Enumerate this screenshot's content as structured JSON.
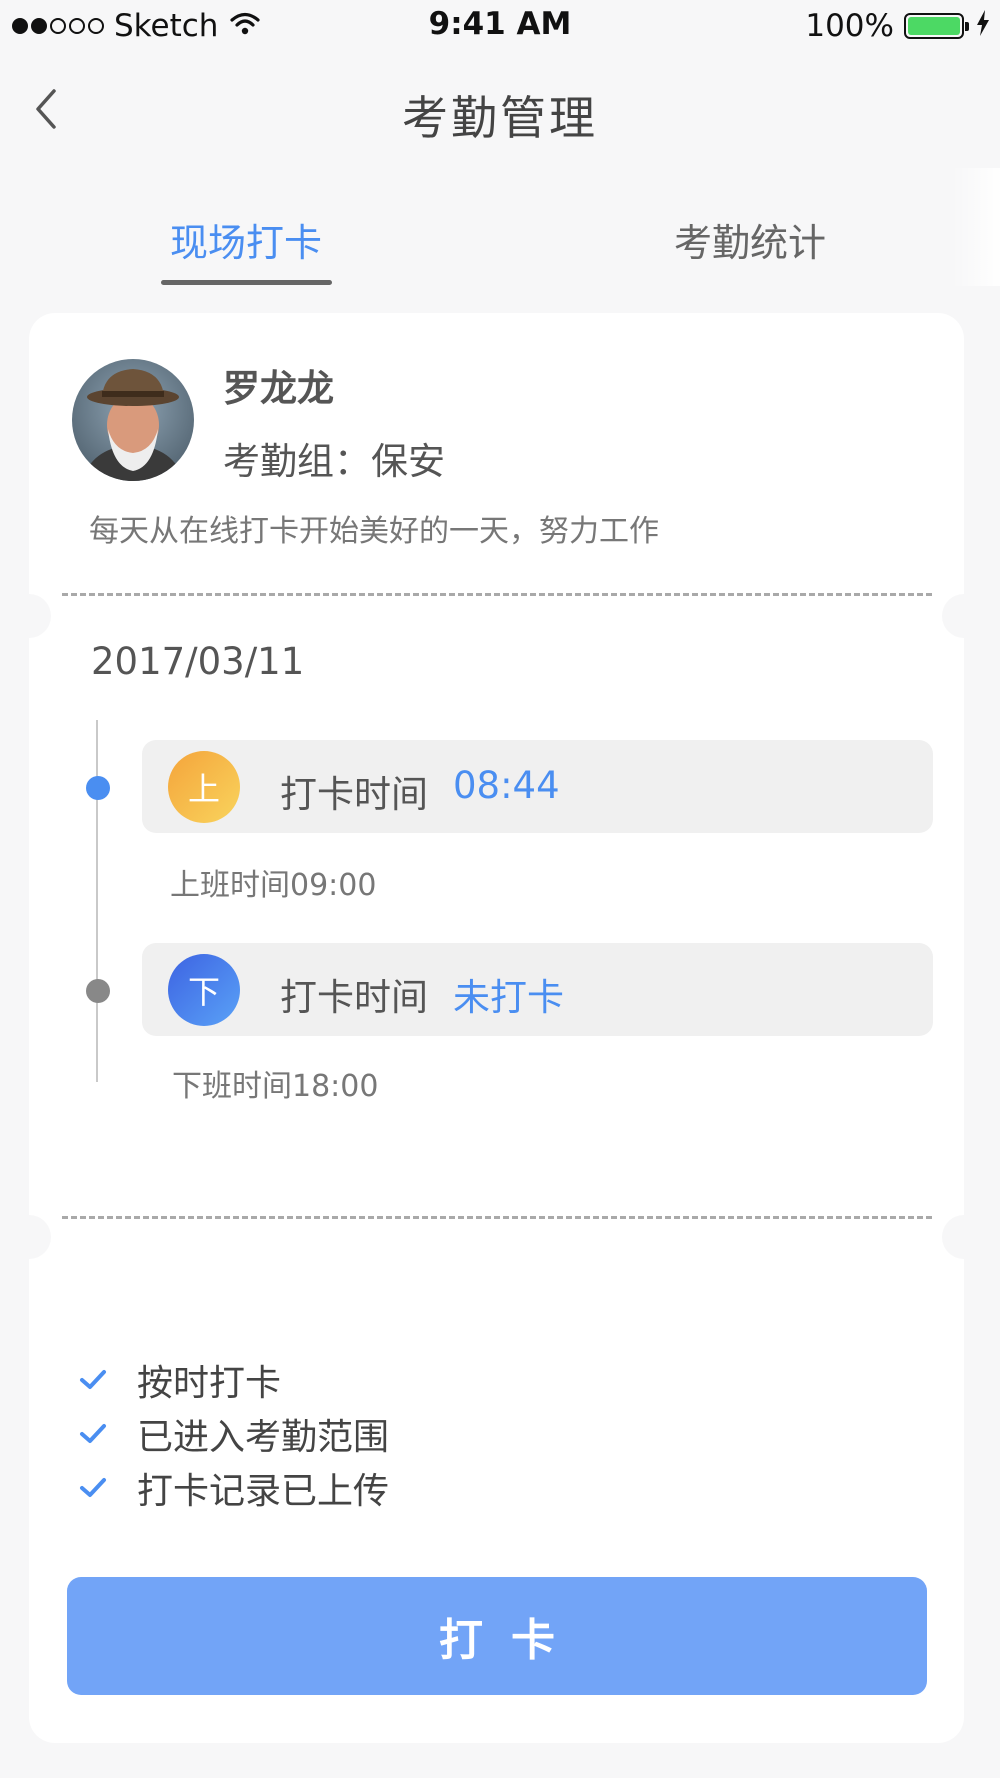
{
  "status_bar": {
    "carrier": "Sketch",
    "time": "9:41 AM",
    "battery": "100%",
    "signal_icon": "signal-dots-icon",
    "wifi_icon": "wifi-icon",
    "battery_icon": "battery-icon",
    "charging_icon": "lightning-icon"
  },
  "nav": {
    "title": "考勤管理",
    "back_icon": "chevron-left-icon"
  },
  "tabs": [
    {
      "label": "现场打卡",
      "active": true
    },
    {
      "label": "考勤统计",
      "active": false
    }
  ],
  "profile": {
    "name": "罗龙龙",
    "group": "考勤组：保安",
    "motto": "每天从在线打卡开始美好的一天，努力工作"
  },
  "date": "2017/03/11",
  "punches": [
    {
      "badge": "上",
      "label": "打卡时间",
      "value": "08:44",
      "schedule": "上班时间09:00"
    },
    {
      "badge": "下",
      "label": "打卡时间",
      "value": "未打卡",
      "schedule": "下班时间18:00"
    }
  ],
  "checks": [
    {
      "text": "按时打卡",
      "icon": "check-icon"
    },
    {
      "text": "已进入考勤范围",
      "icon": "check-icon"
    },
    {
      "text": "打卡记录已上传",
      "icon": "check-icon"
    }
  ],
  "button": {
    "label": "打卡"
  },
  "colors": {
    "accent": "#4a8ef1",
    "button": "#72a4f7",
    "battery": "#4cd964",
    "badge_up": "#f4a43b",
    "badge_down": "#3d63e2"
  }
}
